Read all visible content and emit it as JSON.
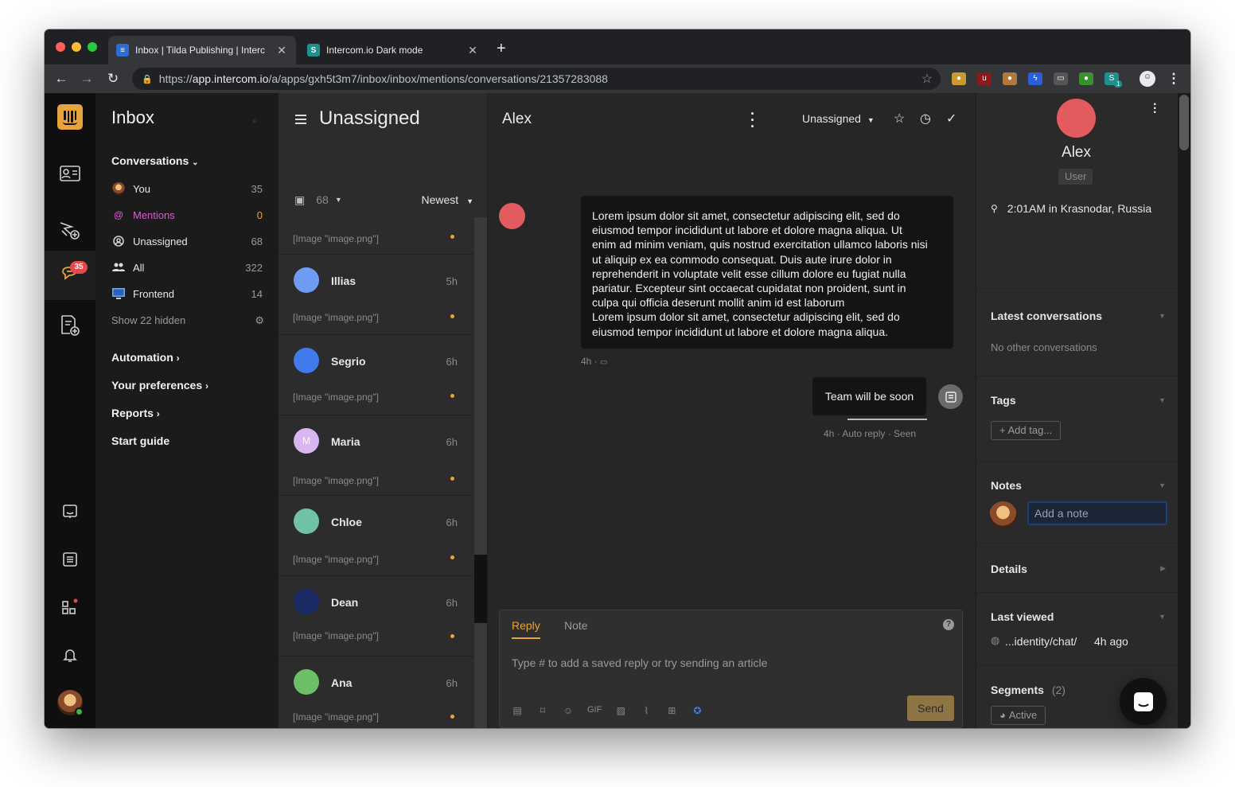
{
  "browser": {
    "tabs": [
      {
        "title": "Inbox | Tilda Publishing | Interc",
        "active": true,
        "favicon": "intercom-icon"
      },
      {
        "title": "Intercom.io Dark mode",
        "active": false,
        "favicon": "stylus-icon"
      }
    ],
    "url_scheme": "https://",
    "url_host": "app.intercom.io",
    "url_path": "/a/apps/gxh5t3m7/inbox/inbox/mentions/conversations/21357283088",
    "new_tab_label": "+",
    "ext_badge": "1"
  },
  "rail": {
    "unread_badge": "35",
    "icons": [
      "intercom-logo-icon",
      "contacts-icon",
      "outbound-icon",
      "inbox-icon",
      "articles-icon",
      "messenger-icon",
      "book-icon",
      "apps-icon",
      "notifications-icon"
    ]
  },
  "nav": {
    "title": "Inbox",
    "conversations_label": "Conversations",
    "items": [
      {
        "label": "You",
        "count": "35",
        "icon": "avatar"
      },
      {
        "label": "Mentions",
        "count": "0",
        "icon": "at-icon"
      },
      {
        "label": "Unassigned",
        "count": "68",
        "icon": "unassigned-icon"
      },
      {
        "label": "All",
        "count": "322",
        "icon": "team-icon"
      },
      {
        "label": "Frontend",
        "count": "14",
        "icon": "monitor-icon"
      }
    ],
    "show_hidden": "Show 22 hidden",
    "sections": [
      {
        "label": "Automation"
      },
      {
        "label": "Your preferences"
      },
      {
        "label": "Reports"
      },
      {
        "label": "Start guide"
      }
    ]
  },
  "list": {
    "title": "Unassigned",
    "count": "68",
    "sort": "Newest",
    "first_preview": "[Image \"image.png\"]",
    "conversations": [
      {
        "name": "Illias",
        "time": "5h",
        "preview": "[Image \"image.png\"]",
        "color": "#6e9cf2",
        "initial": ""
      },
      {
        "name": "Segrio",
        "time": "6h",
        "preview": "[Image \"image.png\"]",
        "color": "#3f7bea",
        "initial": ""
      },
      {
        "name": "Maria",
        "time": "6h",
        "preview": "[Image \"image.png\"]",
        "color": "#d9b6f2",
        "initial": "M"
      },
      {
        "name": "Chloe",
        "time": "6h",
        "preview": "[Image \"image.png\"]",
        "color": "#6fc2a6",
        "initial": ""
      },
      {
        "name": "Dean",
        "time": "6h",
        "preview": "[Image \"image.png\"]",
        "color": "#1c2a66",
        "initial": ""
      },
      {
        "name": "Ana",
        "time": "6h",
        "preview": "[Image \"image.png\"]",
        "color": "#6cbf66",
        "initial": ""
      }
    ]
  },
  "conversation": {
    "contact_name": "Alex",
    "assignee": "Unassigned",
    "message_lines": [
      "Lorem ipsum dolor sit amet, consectetur adipiscing elit, sed do",
      "eiusmod tempor incididunt ut labore et dolore magna aliqua. Ut",
      "enim ad minim veniam, quis nostrud exercitation ullamco laboris nisi",
      "ut aliquip ex ea commodo consequat. Duis aute irure dolor in",
      "reprehenderit in voluptate velit esse cillum dolore eu fugiat nulla",
      "pariatur. Excepteur sint occaecat cupidatat non proident, sunt in",
      "culpa qui officia deserunt mollit anim id est laborum",
      "Lorem ipsum dolor sit amet, consectetur adipiscing elit, sed do",
      "eiusmod tempor incididunt ut labore et dolore magna aliqua."
    ],
    "message_meta": "4h ·",
    "bot_reply": "Team will be soon",
    "bot_meta": "4h · Auto reply · Seen"
  },
  "composer": {
    "reply_tab": "Reply",
    "note_tab": "Note",
    "help": "?",
    "placeholder": "Type # to add a saved reply or try sending an article",
    "gif_label": "GIF",
    "send_label": "Send"
  },
  "side": {
    "name": "Alex",
    "role": "User",
    "location": "2:01AM in Krasnodar, Russia",
    "latest_title": "Latest conversations",
    "latest_empty": "No other conversations",
    "tags_title": "Tags",
    "add_tag": "+ Add tag...",
    "notes_title": "Notes",
    "note_placeholder": "Add a note",
    "details_title": "Details",
    "last_viewed_title": "Last viewed",
    "last_viewed_page": "...identity/chat/",
    "last_viewed_time": "4h ago",
    "segments_title": "Segments",
    "segments_count": "(2)",
    "segment_active": "Active"
  },
  "colors": {
    "accent": "#e8a33d",
    "mention": "#d35ec9",
    "badge": "#e5484d",
    "contact_avatar": "#e25c5f"
  }
}
